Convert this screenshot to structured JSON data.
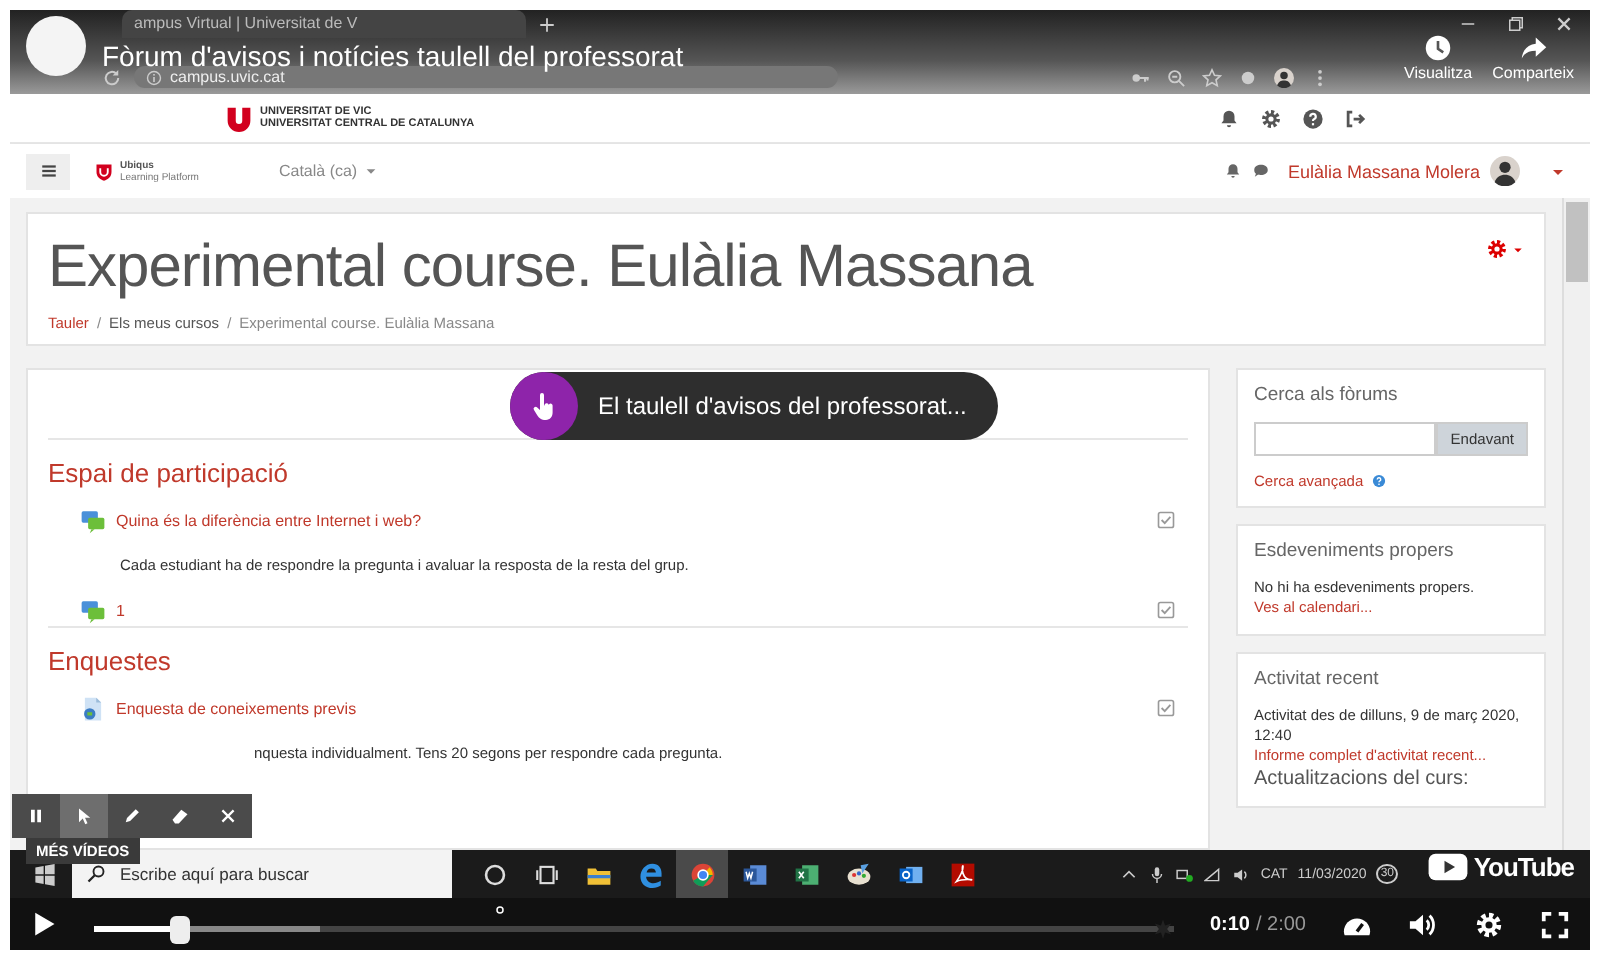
{
  "browser": {
    "tab_title": "ampus Virtual | Universitat de V",
    "url": "campus.uvic.cat"
  },
  "video": {
    "title": "Fòrum d'avisos i notícies taulell del professorat",
    "actions": [
      {
        "kind": "watch_later",
        "label": "Visualitza"
      },
      {
        "kind": "share",
        "label": "Comparteix"
      }
    ],
    "more_videos": "MÉS VÍDEOS",
    "brand": "YouTube"
  },
  "site_header": {
    "lines": [
      "UNIVERSITAT DE VIC",
      "UNIVERSITAT CENTRAL DE CATALUNYA"
    ]
  },
  "navbar": {
    "logo_lines": [
      "Ubiqus",
      "Learning Platform"
    ],
    "language": "Català (ca)",
    "user": "Eulàlia Massana Molera"
  },
  "course": {
    "title": "Experimental course. Eulàlia Massana",
    "separator": "/",
    "breadcrumb": [
      {
        "label": "Tauler",
        "kind": "link"
      },
      {
        "label": "Els meus cursos",
        "kind": "crumb"
      },
      {
        "label": "Experimental course. Eulàlia Massana",
        "kind": "current"
      }
    ]
  },
  "sections": [
    {
      "title": "Espai de participació",
      "activities": [
        {
          "kind": "forum",
          "label": "Quina és la diferència entre Internet i web?",
          "checked": true,
          "description": "Cada estudiant ha de respondre la pregunta i avaluar la resposta de la resta del grup."
        },
        {
          "kind": "forum",
          "label": "1",
          "checked": true
        }
      ]
    },
    {
      "title": "Enquestes",
      "activities": [
        {
          "kind": "survey",
          "label": "Enquesta de coneixements previs",
          "checked": true,
          "description": "nquesta individualment. Tens 20 segons per respondre cada pregunta."
        }
      ]
    }
  ],
  "blocks": [
    {
      "kind": "search",
      "title": "Cerca als fòrums",
      "button": "Endavant",
      "link": "Cerca avançada"
    },
    {
      "kind": "list",
      "title": "Esdeveniments propers",
      "lines": [
        {
          "kind": "text",
          "text": "No hi ha esdeveniments propers."
        },
        {
          "kind": "link",
          "text": "Ves al calendari..."
        }
      ]
    },
    {
      "kind": "list",
      "title": "Activitat recent",
      "lines": [
        {
          "kind": "text",
          "text": "Activitat des de dilluns, 9 de març 2020, 12:40"
        },
        {
          "kind": "link",
          "text": "Informe complet d'activitat recent..."
        },
        {
          "kind": "heading",
          "text": "Actualitzacions del curs:"
        }
      ]
    }
  ],
  "tooltip": "El taulell d'avisos del professorat...",
  "annotation_tools": [
    {
      "kind": "pause",
      "selected": false
    },
    {
      "kind": "pointer",
      "selected": true
    },
    {
      "kind": "pen",
      "selected": false
    },
    {
      "kind": "eraser",
      "selected": false
    },
    {
      "kind": "close",
      "selected": false
    }
  ],
  "taskbar": {
    "search": {
      "placeholder": "Escribe aquí para buscar"
    },
    "apps": [
      {
        "kind": "cortana",
        "selected": false
      },
      {
        "kind": "taskview",
        "selected": false
      },
      {
        "kind": "explorer",
        "selected": false
      },
      {
        "kind": "edge",
        "selected": false
      },
      {
        "kind": "chrome",
        "selected": true
      },
      {
        "kind": "word",
        "selected": false
      },
      {
        "kind": "excel",
        "selected": false
      },
      {
        "kind": "paint",
        "selected": false
      },
      {
        "kind": "outlook",
        "selected": false
      },
      {
        "kind": "acrobat",
        "selected": false
      }
    ],
    "language": "CAT",
    "date": "11/03/2020",
    "notifications": "30"
  },
  "player": {
    "playing": false,
    "progress": {
      "level": 0.08
    },
    "buffered": {
      "level": 0.21
    },
    "time_current": "0:10",
    "time_total": "/ 2:00"
  }
}
